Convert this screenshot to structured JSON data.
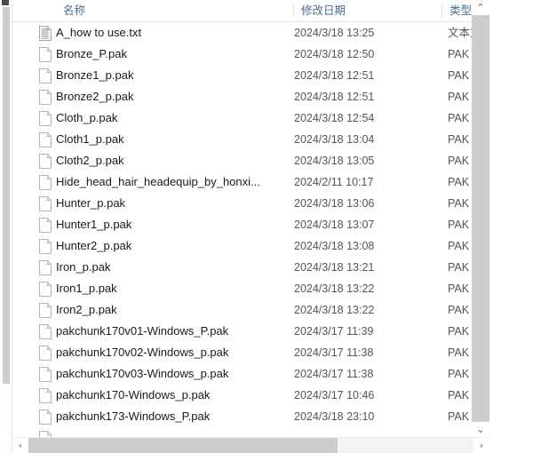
{
  "window": {
    "view_mode": "details-list"
  },
  "columns": {
    "name_header": "名称",
    "date_header": "修改日期",
    "type_header": "类型"
  },
  "files": [
    {
      "name": "A_how to use.txt",
      "date": "2024/3/18 13:25",
      "type": "文本文",
      "icon": "text-file-icon"
    },
    {
      "name": "Bronze_P.pak",
      "date": "2024/3/18 12:50",
      "type": "PAK 文",
      "icon": "blank-file-icon"
    },
    {
      "name": "Bronze1_p.pak",
      "date": "2024/3/18 12:51",
      "type": "PAK 文",
      "icon": "blank-file-icon"
    },
    {
      "name": "Bronze2_p.pak",
      "date": "2024/3/18 12:51",
      "type": "PAK 文",
      "icon": "blank-file-icon"
    },
    {
      "name": "Cloth_p.pak",
      "date": "2024/3/18 12:54",
      "type": "PAK 文",
      "icon": "blank-file-icon"
    },
    {
      "name": "Cloth1_p.pak",
      "date": "2024/3/18 13:04",
      "type": "PAK 文",
      "icon": "blank-file-icon"
    },
    {
      "name": "Cloth2_p.pak",
      "date": "2024/3/18 13:05",
      "type": "PAK 文",
      "icon": "blank-file-icon"
    },
    {
      "name": "Hide_head_hair_headequip_by_honxi...",
      "date": "2024/2/11 10:17",
      "type": "PAK 文",
      "icon": "blank-file-icon"
    },
    {
      "name": "Hunter_p.pak",
      "date": "2024/3/18 13:06",
      "type": "PAK 文",
      "icon": "blank-file-icon"
    },
    {
      "name": "Hunter1_p.pak",
      "date": "2024/3/18 13:07",
      "type": "PAK 文",
      "icon": "blank-file-icon"
    },
    {
      "name": "Hunter2_p.pak",
      "date": "2024/3/18 13:08",
      "type": "PAK 文",
      "icon": "blank-file-icon"
    },
    {
      "name": "Iron_p.pak",
      "date": "2024/3/18 13:21",
      "type": "PAK 文",
      "icon": "blank-file-icon"
    },
    {
      "name": "Iron1_p.pak",
      "date": "2024/3/18 13:22",
      "type": "PAK 文",
      "icon": "blank-file-icon"
    },
    {
      "name": "Iron2_p.pak",
      "date": "2024/3/18 13:22",
      "type": "PAK 文",
      "icon": "blank-file-icon"
    },
    {
      "name": "pakchunk170v01-Windows_P.pak",
      "date": "2024/3/17 11:39",
      "type": "PAK 文",
      "icon": "blank-file-icon"
    },
    {
      "name": "pakchunk170v02-Windows_p.pak",
      "date": "2024/3/17 11:38",
      "type": "PAK 文",
      "icon": "blank-file-icon"
    },
    {
      "name": "pakchunk170v03-Windows_p.pak",
      "date": "2024/3/17 11:38",
      "type": "PAK 文",
      "icon": "blank-file-icon"
    },
    {
      "name": "pakchunk170-Windows_p.pak",
      "date": "2024/3/17 10:46",
      "type": "PAK 文",
      "icon": "blank-file-icon"
    },
    {
      "name": "pakchunk173-Windows_P.pak",
      "date": "2024/3/18 23:10",
      "type": "PAK 文",
      "icon": "blank-file-icon"
    },
    {
      "name": "",
      "date": "",
      "type": "",
      "icon": "blank-file-icon"
    }
  ],
  "scrollbars": {
    "vertical": {
      "up_arrow": "⌃",
      "down_arrow": "⌄"
    },
    "horizontal": {
      "left_arrow": "‹",
      "right_arrow": "›"
    }
  },
  "colors": {
    "header_text": "#4a6c8f",
    "row_text": "#1a1a1a",
    "meta_text": "#555555",
    "scroll_thumb": "#cdcdcd",
    "background": "#ffffff"
  }
}
